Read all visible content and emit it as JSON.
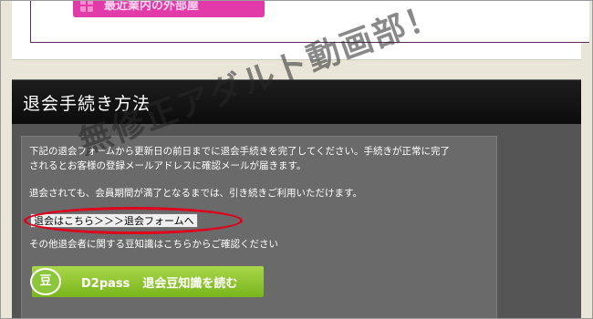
{
  "top_banner": {
    "button_label": "最近業内の外部屋",
    "icon": "grid-icon",
    "color": "#e23aa8"
  },
  "section": {
    "title": "退会手続き方法",
    "paragraph1_line1": "下記の退会フォームから更新日の前日までに退会手続きを完了してください。手続きが正常に完了",
    "paragraph1_line2": "されるとお客様の登録メールアドレスに確認メールが届きます。",
    "paragraph2": "退会されても、会員期間が満了となるまでは、引き続きご利用いただけます。",
    "cancel_button": "退会はこちら＞＞＞退会フォームへ",
    "paragraph3": "その他退会者に関する豆知識はこちらからご確認ください",
    "knowledge_button": {
      "icon_glyph": "豆",
      "brand": "D2pass",
      "label": "退会豆知識を読む",
      "color": "#8cc63a"
    }
  },
  "watermark": "無修正アダルト動画部！",
  "highlight_color": "#e0001b"
}
